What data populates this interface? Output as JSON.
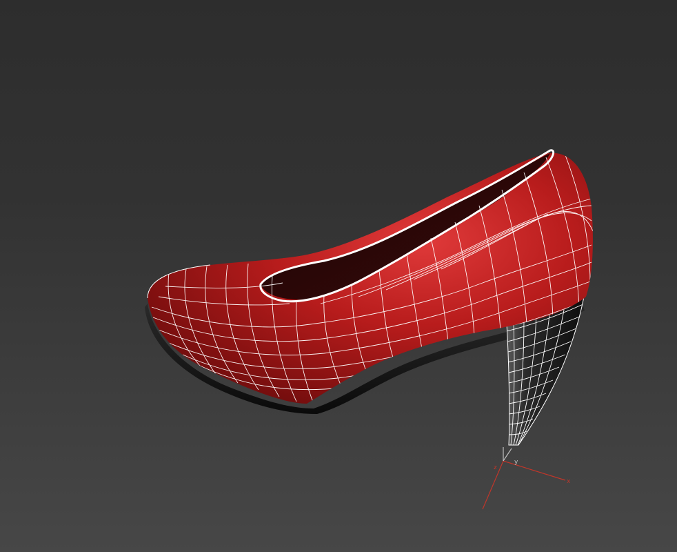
{
  "viewport": {
    "shading": "smooth-with-edged-faces",
    "background_top": "#2d2d2d",
    "background_bottom": "#474747"
  },
  "model": {
    "object": "high-heel-shoe",
    "upper_color": "#b01818",
    "heel_color": "#1a1a1a",
    "wireframe_color": "#ffffff",
    "selected": true
  },
  "gizmo": {
    "axes": [
      {
        "name": "x",
        "label": "x",
        "color": "#c0362a"
      },
      {
        "name": "y",
        "label": "y",
        "color": "#c0c0c0"
      },
      {
        "name": "z",
        "label": "z",
        "color": "#c0362a"
      }
    ]
  }
}
